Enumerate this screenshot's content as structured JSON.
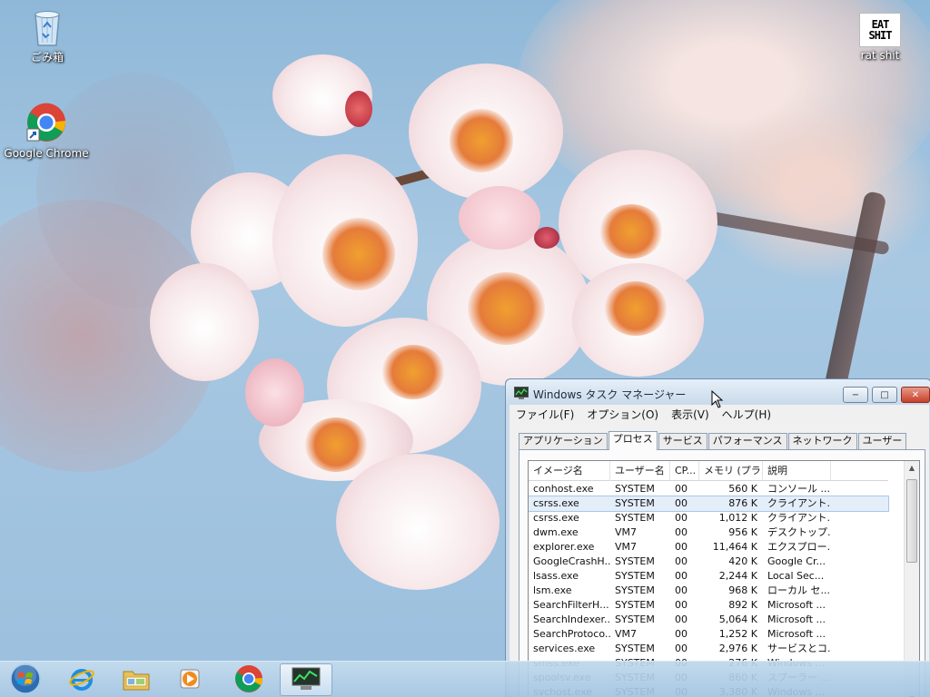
{
  "desktop": {
    "icons": [
      {
        "label": "ごみ箱",
        "icon": "recycle-bin-icon"
      },
      {
        "label": "Google Chrome",
        "icon": "chrome-shortcut-icon"
      },
      {
        "label": "rat shit",
        "icon": "eat-shit-image-icon",
        "image_text": "EAT SHIT"
      }
    ]
  },
  "taskbar": {
    "buttons": [
      {
        "name": "start",
        "icon": "windows-start-orb-icon"
      },
      {
        "name": "internet-explorer",
        "icon": "internet-explorer-icon"
      },
      {
        "name": "explorer",
        "icon": "folder-icon"
      },
      {
        "name": "media-player",
        "icon": "media-player-icon"
      },
      {
        "name": "chrome",
        "icon": "chrome-icon"
      },
      {
        "name": "task-manager",
        "icon": "task-manager-icon",
        "active": true
      }
    ]
  },
  "task_manager": {
    "title": "Windows タスク マネージャー",
    "caption_buttons": {
      "minimize": "−",
      "maximize": "□",
      "close": "✕"
    },
    "menu": [
      "ファイル(F)",
      "オプション(O)",
      "表示(V)",
      "ヘルプ(H)"
    ],
    "tabs": [
      "アプリケーション",
      "プロセス",
      "サービス",
      "パフォーマンス",
      "ネットワーク",
      "ユーザー"
    ],
    "active_tab": "プロセス",
    "columns": [
      "イメージ名",
      "ユーザー名",
      "CP...",
      "メモリ (プラ...",
      "説明"
    ],
    "selected_row": 1,
    "processes": [
      {
        "name": "conhost.exe",
        "user": "SYSTEM",
        "cpu": "00",
        "mem": "560 K",
        "desc": "コンソール ..."
      },
      {
        "name": "csrss.exe",
        "user": "SYSTEM",
        "cpu": "00",
        "mem": "876 K",
        "desc": "クライアント..."
      },
      {
        "name": "csrss.exe",
        "user": "SYSTEM",
        "cpu": "00",
        "mem": "1,012 K",
        "desc": "クライアント..."
      },
      {
        "name": "dwm.exe",
        "user": "VM7",
        "cpu": "00",
        "mem": "956 K",
        "desc": "デスクトップ..."
      },
      {
        "name": "explorer.exe",
        "user": "VM7",
        "cpu": "00",
        "mem": "11,464 K",
        "desc": "エクスプロー..."
      },
      {
        "name": "GoogleCrashH...",
        "user": "SYSTEM",
        "cpu": "00",
        "mem": "420 K",
        "desc": "Google Cr..."
      },
      {
        "name": "lsass.exe",
        "user": "SYSTEM",
        "cpu": "00",
        "mem": "2,244 K",
        "desc": "Local Sec..."
      },
      {
        "name": "lsm.exe",
        "user": "SYSTEM",
        "cpu": "00",
        "mem": "968 K",
        "desc": "ローカル セ..."
      },
      {
        "name": "SearchFilterH...",
        "user": "SYSTEM",
        "cpu": "00",
        "mem": "892 K",
        "desc": "Microsoft ..."
      },
      {
        "name": "SearchIndexer...",
        "user": "SYSTEM",
        "cpu": "00",
        "mem": "5,064 K",
        "desc": "Microsoft ..."
      },
      {
        "name": "SearchProtoco...",
        "user": "VM7",
        "cpu": "00",
        "mem": "1,252 K",
        "desc": "Microsoft ..."
      },
      {
        "name": "services.exe",
        "user": "SYSTEM",
        "cpu": "00",
        "mem": "2,976 K",
        "desc": "サービスとコ..."
      },
      {
        "name": "smss.exe",
        "user": "SYSTEM",
        "cpu": "00",
        "mem": "276 K",
        "desc": "Windows ..."
      },
      {
        "name": "spoolsv.exe",
        "user": "SYSTEM",
        "cpu": "00",
        "mem": "860 K",
        "desc": "スプーラー ..."
      },
      {
        "name": "svchost.exe",
        "user": "SYSTEM",
        "cpu": "00",
        "mem": "3,380 K",
        "desc": "Windows ..."
      }
    ]
  },
  "colors": {
    "sky": "#9cc0de",
    "blossom": "#f7e8ea",
    "stamen": "#e57b3a",
    "window_frame": "#c9daeb",
    "selection": "#e4eef9"
  }
}
